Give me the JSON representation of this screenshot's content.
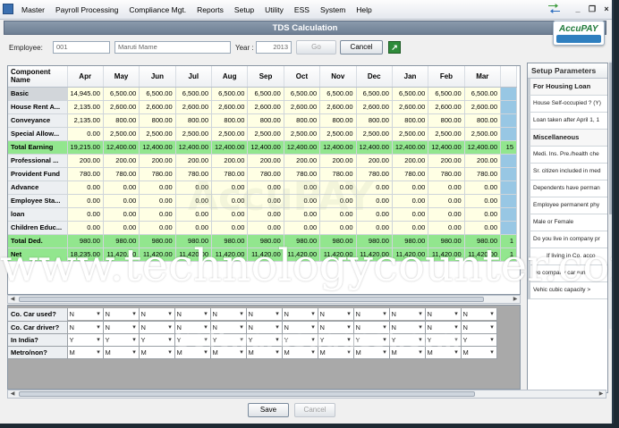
{
  "menubar": {
    "items": [
      "Master",
      "Payroll Processing",
      "Compliance Mgt.",
      "Reports",
      "Setup",
      "Utility",
      "ESS",
      "System",
      "Help"
    ]
  },
  "window": {
    "title": "TDS Calculation",
    "min": "_",
    "restore": "❐",
    "close": "×"
  },
  "brand": {
    "name": "AccuPAY"
  },
  "filter": {
    "employee_label": "Employee:",
    "employee_code": "001",
    "employee_name": "Maruti Mame",
    "year_label": "Year :",
    "year_value": "2013",
    "go_label": "Go",
    "cancel_label": "Cancel",
    "export_icon": "excel-export-icon"
  },
  "grid": {
    "header_first": "Component Name",
    "months": [
      "Apr",
      "May",
      "Jun",
      "Jul",
      "Aug",
      "Sep",
      "Oct",
      "Nov",
      "Dec",
      "Jan",
      "Feb",
      "Mar"
    ],
    "rows": [
      {
        "name": "Basic",
        "values": [
          "14,945.00",
          "6,500.00",
          "6,500.00",
          "6,500.00",
          "6,500.00",
          "6,500.00",
          "6,500.00",
          "6,500.00",
          "6,500.00",
          "6,500.00",
          "6,500.00",
          "6,500.00"
        ],
        "extra": "",
        "style": "normal"
      },
      {
        "name": "House Rent A...",
        "values": [
          "2,135.00",
          "2,600.00",
          "2,600.00",
          "2,600.00",
          "2,600.00",
          "2,600.00",
          "2,600.00",
          "2,600.00",
          "2,600.00",
          "2,600.00",
          "2,600.00",
          "2,600.00"
        ],
        "extra": "",
        "style": "normal"
      },
      {
        "name": "Conveyance",
        "values": [
          "2,135.00",
          "800.00",
          "800.00",
          "800.00",
          "800.00",
          "800.00",
          "800.00",
          "800.00",
          "800.00",
          "800.00",
          "800.00",
          "800.00"
        ],
        "extra": "",
        "style": "normal"
      },
      {
        "name": "Special Allow...",
        "values": [
          "0.00",
          "2,500.00",
          "2,500.00",
          "2,500.00",
          "2,500.00",
          "2,500.00",
          "2,500.00",
          "2,500.00",
          "2,500.00",
          "2,500.00",
          "2,500.00",
          "2,500.00"
        ],
        "extra": "",
        "style": "normal"
      },
      {
        "name": "Total Earning",
        "values": [
          "19,215.00",
          "12,400.00",
          "12,400.00",
          "12,400.00",
          "12,400.00",
          "12,400.00",
          "12,400.00",
          "12,400.00",
          "12,400.00",
          "12,400.00",
          "12,400.00",
          "12,400.00"
        ],
        "extra": "15",
        "style": "green"
      },
      {
        "name": "Professional ...",
        "values": [
          "200.00",
          "200.00",
          "200.00",
          "200.00",
          "200.00",
          "200.00",
          "200.00",
          "200.00",
          "200.00",
          "200.00",
          "200.00",
          "200.00"
        ],
        "extra": "",
        "style": "normal"
      },
      {
        "name": "Provident Fund",
        "values": [
          "780.00",
          "780.00",
          "780.00",
          "780.00",
          "780.00",
          "780.00",
          "780.00",
          "780.00",
          "780.00",
          "780.00",
          "780.00",
          "780.00"
        ],
        "extra": "",
        "style": "normal"
      },
      {
        "name": "Advance",
        "values": [
          "0.00",
          "0.00",
          "0.00",
          "0.00",
          "0.00",
          "0.00",
          "0.00",
          "0.00",
          "0.00",
          "0.00",
          "0.00",
          "0.00"
        ],
        "extra": "",
        "style": "normal"
      },
      {
        "name": "Employee Sta...",
        "values": [
          "0.00",
          "0.00",
          "0.00",
          "0.00",
          "0.00",
          "0.00",
          "0.00",
          "0.00",
          "0.00",
          "0.00",
          "0.00",
          "0.00"
        ],
        "extra": "",
        "style": "normal"
      },
      {
        "name": "loan",
        "values": [
          "0.00",
          "0.00",
          "0.00",
          "0.00",
          "0.00",
          "0.00",
          "0.00",
          "0.00",
          "0.00",
          "0.00",
          "0.00",
          "0.00"
        ],
        "extra": "",
        "style": "normal"
      },
      {
        "name": "Children Educ...",
        "values": [
          "0.00",
          "0.00",
          "0.00",
          "0.00",
          "0.00",
          "0.00",
          "0.00",
          "0.00",
          "0.00",
          "0.00",
          "0.00",
          "0.00"
        ],
        "extra": "",
        "style": "normal"
      },
      {
        "name": "Total Ded.",
        "values": [
          "980.00",
          "980.00",
          "980.00",
          "980.00",
          "980.00",
          "980.00",
          "980.00",
          "980.00",
          "980.00",
          "980.00",
          "980.00",
          "980.00"
        ],
        "extra": "1",
        "style": "green"
      },
      {
        "name": "Net",
        "values": [
          "18,235.00",
          "11,420.00",
          "11,420.00",
          "11,420.00",
          "11,420.00",
          "11,420.00",
          "11,420.00",
          "11,420.00",
          "11,420.00",
          "11,420.00",
          "11,420.00",
          "11,420.00"
        ],
        "extra": "1",
        "style": "green"
      }
    ]
  },
  "options_grid": {
    "rows": [
      {
        "name": "Co. Car used?",
        "value": "N"
      },
      {
        "name": "Co. Car driver?",
        "value": "N"
      },
      {
        "name": "In India?",
        "value": "Y"
      },
      {
        "name": "Metro/non?",
        "value": "M"
      }
    ],
    "columns": 12
  },
  "side_panel": {
    "title": "Setup Parameters",
    "rows": [
      {
        "text": "For Housing Loan",
        "type": "sec"
      },
      {
        "text": "House Self-occupied ? (Y)",
        "type": "item"
      },
      {
        "text": "Loan taken after April 1, 1",
        "type": "item"
      },
      {
        "text": "Miscellaneous",
        "type": "sec"
      },
      {
        "text": "Medi. Ins. Pre./health che",
        "type": "item"
      },
      {
        "text": "Sr. citizen included in med",
        "type": "item"
      },
      {
        "text": "Dependents have perman",
        "type": "item"
      },
      {
        "text": "Employee permanent phy",
        "type": "item"
      },
      {
        "text": "Male or Female",
        "type": "item"
      },
      {
        "text": "Do you live in company pr",
        "type": "item"
      },
      {
        "text": "If living in Co. acco",
        "type": "ind"
      },
      {
        "text": "Do           company car runni",
        "type": "item"
      },
      {
        "text": "Vehic      cubic     capacity >",
        "type": "item"
      }
    ]
  },
  "footer": {
    "save_label": "Save",
    "cancel_label": "Cancel"
  },
  "watermarks": {
    "main": "www.technologycounter.com",
    "secondary": "Softwaresuggest.com",
    "faint": "AccuPAY"
  }
}
